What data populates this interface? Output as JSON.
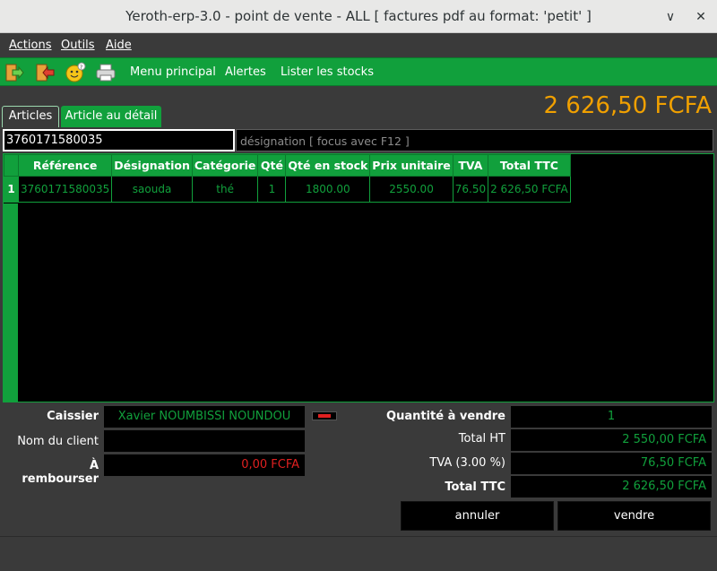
{
  "window": {
    "title": "Yeroth-erp-3.0 - point de vente - ALL  [ factures pdf au format: 'petit' ]",
    "minimize": "∨",
    "close": "✕"
  },
  "menu": {
    "actions": "Actions",
    "outils": "Outils",
    "aide": "Aide"
  },
  "toolbar": {
    "menu_principal": "Menu principal",
    "alertes": "Alertes",
    "lister_stocks": "Lister les stocks"
  },
  "tabs": {
    "articles": "Articles",
    "detail": "Article au détail"
  },
  "total_display": "2 626,50 FCFA",
  "search": {
    "value": "3760171580035",
    "designation_placeholder": "désignation [ focus avec F12 ]"
  },
  "table": {
    "headers": [
      "Référence",
      "Désignation",
      "Catégorie",
      "Qté",
      "Qté en stock",
      "Prix unitaire",
      "TVA",
      "Total TTC"
    ],
    "rows": [
      {
        "num": "1",
        "cells": [
          "3760171580035",
          "saouda",
          "thé",
          "1",
          "1800.00",
          "2550.00",
          "76.50",
          "2 626,50 FCFA"
        ]
      }
    ]
  },
  "form": {
    "caissier_label": "Caissier",
    "caissier_value": "Xavier NOUMBISSI NOUNDOU",
    "client_label": "Nom du client",
    "client_value": "",
    "rembourser_label": "À rembourser",
    "rembourser_value": "0,00 FCFA",
    "quantite_label": "Quantité à vendre",
    "quantite_value": "1",
    "total_ht_label": "Total HT",
    "total_ht_value": "2 550,00 FCFA",
    "tva_label": "TVA (3.00 %)",
    "tva_value": "76,50 FCFA",
    "total_ttc_label": "Total TTC",
    "total_ttc_value": "2 626,50 FCFA"
  },
  "buttons": {
    "annuler": "annuler",
    "vendre": "vendre"
  },
  "colors": {
    "accent": "#11a03c",
    "total": "#f0a000",
    "alert": "#e02020"
  }
}
